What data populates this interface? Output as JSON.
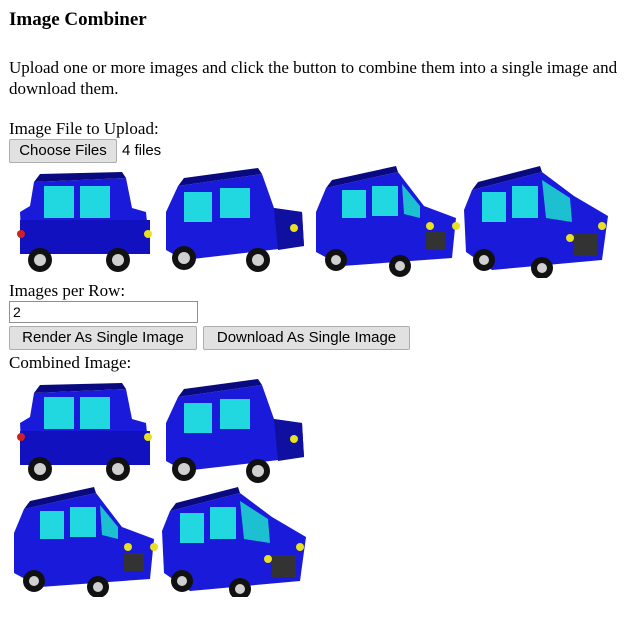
{
  "page": {
    "title": "Image Combiner",
    "intro": "Upload one or more images and click the button to combine them into a single image and download them."
  },
  "upload": {
    "label": "Image File to Upload:",
    "button_label": "Choose Files",
    "status": "4 files"
  },
  "thumbnails": [
    {
      "icon": "blue-car-front-icon"
    },
    {
      "icon": "blue-car-angled-icon"
    },
    {
      "icon": "blue-car-three-quarter-icon"
    },
    {
      "icon": "blue-car-right-icon"
    }
  ],
  "settings": {
    "images_per_row_label": "Images per Row:",
    "images_per_row_value": "2"
  },
  "actions": {
    "render_label": "Render As Single Image",
    "download_label": "Download As Single Image"
  },
  "combined": {
    "label": "Combined Image:"
  },
  "colors": {
    "car_body": "#1a1adb",
    "car_dark": "#0a0a80",
    "window": "#22d8e0",
    "wheel": "#111111",
    "hubcap": "#d0d0d0",
    "headlight": "#e8e020",
    "taillight": "#cc2222"
  }
}
